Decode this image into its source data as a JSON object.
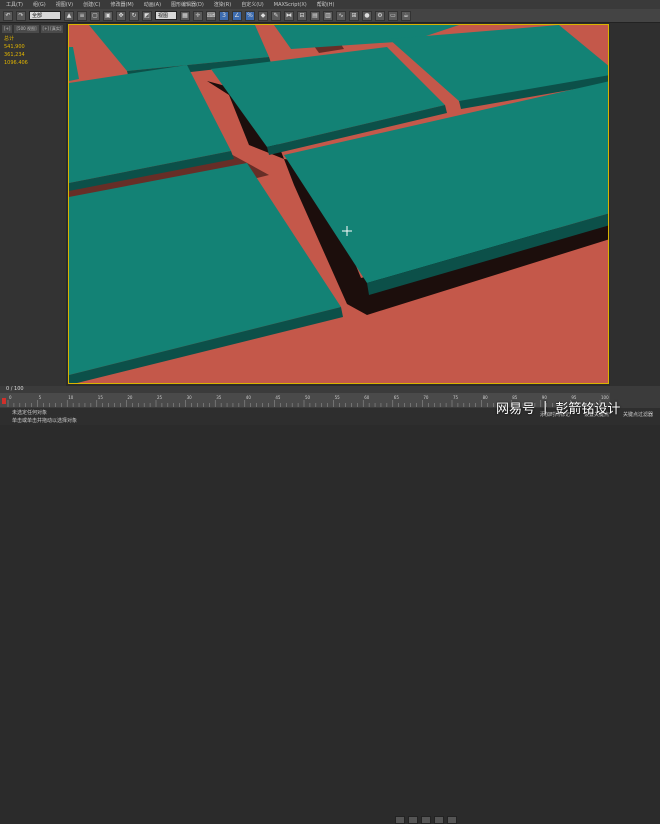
{
  "menu": {
    "items": [
      "工具(T)",
      "组(G)",
      "视图(V)",
      "创建(C)",
      "修改器(M)",
      "动画(A)",
      "图形编辑器(D)",
      "渲染(R)",
      "自定义(U)",
      "MAXScript(X)",
      "帮助(H)"
    ]
  },
  "toolbar": {
    "selection_filter": "全部",
    "view_select": "视图",
    "buttons": [
      "undo",
      "redo",
      "select",
      "select-region",
      "move",
      "rotate",
      "scale",
      "snap",
      "angle-snap",
      "percent-snap",
      "mirror",
      "align",
      "curve-editor",
      "material-editor",
      "render-setup",
      "render",
      "teapot"
    ]
  },
  "left_panel": {
    "tabs": [
      "[+]",
      "[500 视图]",
      "[+] [真实]"
    ],
    "stats": [
      "总计",
      "541,900",
      "361,234",
      "",
      "1096.406"
    ]
  },
  "colors": {
    "floor": "#c4584a",
    "tile_top": "#138275",
    "tile_side": "#0c5049",
    "shadow": "#1c0e0c",
    "viewport_border": "#d9b300"
  },
  "timeline": {
    "frame_label": "0 / 100",
    "ticks": [
      "0",
      "5",
      "10",
      "15",
      "20",
      "25",
      "30",
      "35",
      "40",
      "45",
      "50",
      "55",
      "60",
      "65",
      "70",
      "75",
      "80",
      "85",
      "90",
      "95",
      "100"
    ]
  },
  "status": {
    "line1": "未选定任何对象",
    "line2": "单击或单击并拖动以选择对象",
    "add_time_tag": "添加时间标记",
    "set_key": "设置关键点",
    "key_filters": "关键点过滤器"
  },
  "watermark": {
    "brand": "网易号",
    "separator": "|",
    "author": "彭箭铭设计"
  }
}
